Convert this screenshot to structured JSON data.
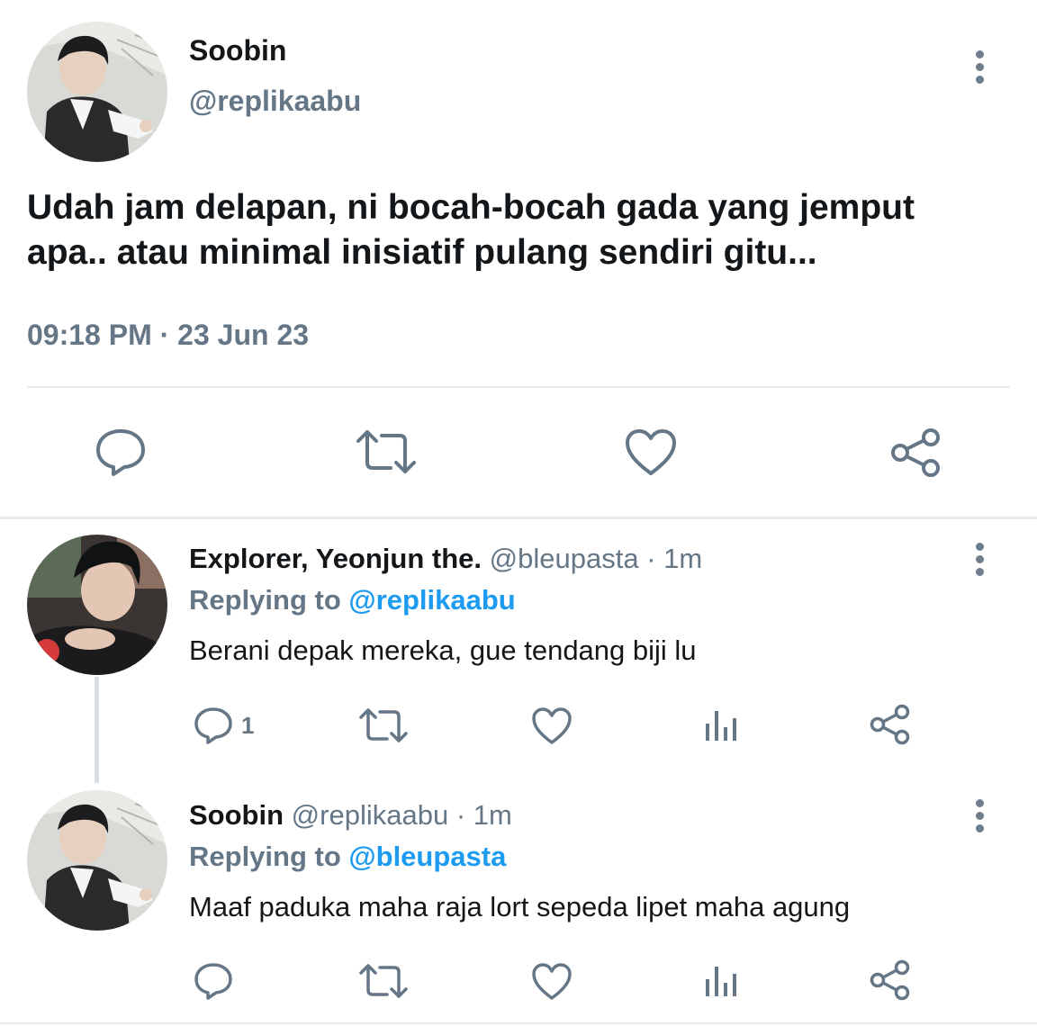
{
  "main_tweet": {
    "display_name": "Soobin",
    "handle": "@replikaabu",
    "text_line1": "Udah jam delapan, ni bocah-bocah gada yang jemput",
    "text_line2": "apa.. atau minimal inisiatif pulang sendiri gitu...",
    "time": "09:18 PM",
    "separator": "·",
    "date": "23 Jun 23",
    "actions": [
      "reply-icon",
      "retweet-icon",
      "like-icon",
      "share-icon"
    ]
  },
  "replies": [
    {
      "display_name": "Explorer, Yeonjun the.",
      "handle": "@bleupasta",
      "separator": "·",
      "time_ago": "1m",
      "replying_prefix": "Replying to",
      "replying_to": "@replikaabu",
      "text": "Berani depak mereka, gue tendang biji lu",
      "reply_count": "1",
      "actions": [
        "reply-icon",
        "retweet-icon",
        "like-icon",
        "analytics-icon",
        "share-icon"
      ]
    },
    {
      "display_name": "Soobin",
      "handle": "@replikaabu",
      "separator": "·",
      "time_ago": "1m",
      "replying_prefix": "Replying to",
      "replying_to": "@bleupasta",
      "text": "Maaf paduka maha raja lort sepeda lipet maha agung",
      "reply_count": "",
      "actions": [
        "reply-icon",
        "retweet-icon",
        "like-icon",
        "analytics-icon",
        "share-icon"
      ]
    }
  ],
  "colors": {
    "text": "#14171a",
    "muted": "#657786",
    "link": "#1d9bf0",
    "divider": "#e6ecf0"
  }
}
